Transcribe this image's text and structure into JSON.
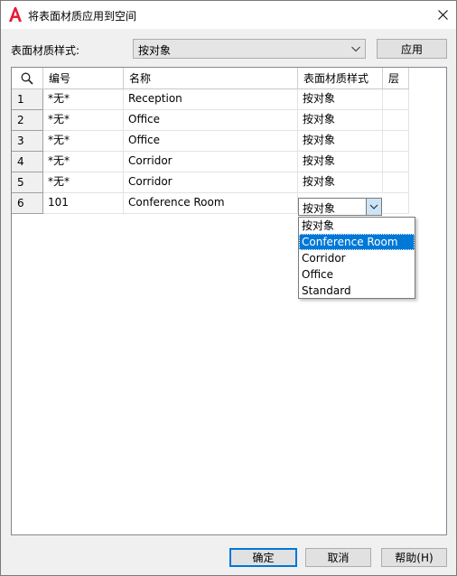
{
  "window": {
    "title": "将表面材质应用到空间"
  },
  "form": {
    "style_label": "表面材质样式:",
    "style_value": "按对象",
    "apply_label": "应用"
  },
  "grid": {
    "columns": [
      "编号",
      "名称",
      "表面材质样式",
      "层"
    ],
    "rows": [
      {
        "index": "1",
        "number": "*无*",
        "name": "Reception",
        "style": "按对象"
      },
      {
        "index": "2",
        "number": "*无*",
        "name": "Office",
        "style": "按对象"
      },
      {
        "index": "3",
        "number": "*无*",
        "name": "Office",
        "style": "按对象"
      },
      {
        "index": "4",
        "number": "*无*",
        "name": "Corridor",
        "style": "按对象"
      },
      {
        "index": "5",
        "number": "*无*",
        "name": "Corridor",
        "style": "按对象"
      },
      {
        "index": "6",
        "number": "101",
        "name": "Conference Room",
        "style": "按对象"
      }
    ],
    "dropdown_options": [
      "按对象",
      "Conference Room",
      "Corridor",
      "Office",
      "Standard"
    ],
    "dropdown_selected": "Conference Room"
  },
  "footer": {
    "ok_label": "确定",
    "cancel_label": "取消",
    "help_label": "帮助(H)"
  },
  "colors": {
    "accent": "#0078d7",
    "logo_red": "#e51937"
  }
}
